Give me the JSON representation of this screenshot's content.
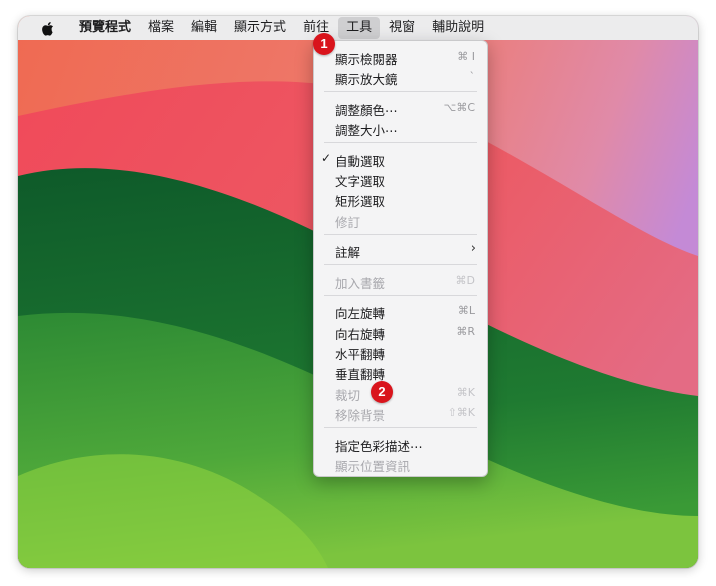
{
  "menubar": {
    "apple_icon": "apple-logo-icon",
    "items": [
      {
        "label": "預覽程式"
      },
      {
        "label": "檔案"
      },
      {
        "label": "編輯"
      },
      {
        "label": "顯示方式"
      },
      {
        "label": "前往"
      },
      {
        "label": "工具"
      },
      {
        "label": "視窗"
      },
      {
        "label": "輔助說明"
      }
    ]
  },
  "tools_menu": {
    "items": [
      {
        "label": "顯示檢閱器",
        "shortcut": "⌘ I",
        "enabled": true
      },
      {
        "label": "顯示放大鏡",
        "shortcut": "`",
        "enabled": true
      },
      {
        "label": "調整顏色⋯",
        "shortcut": "⌥⌘C",
        "enabled": true
      },
      {
        "label": "調整大小⋯",
        "shortcut": "",
        "enabled": true
      },
      {
        "label": "自動選取",
        "shortcut": "",
        "enabled": true,
        "checked": true
      },
      {
        "label": "文字選取",
        "shortcut": "",
        "enabled": true
      },
      {
        "label": "矩形選取",
        "shortcut": "",
        "enabled": true
      },
      {
        "label": "修訂",
        "shortcut": "",
        "enabled": false
      },
      {
        "label": "註解",
        "shortcut": "",
        "enabled": true,
        "submenu": true
      },
      {
        "label": "加入書籤",
        "shortcut": "⌘D",
        "enabled": false
      },
      {
        "label": "向左旋轉",
        "shortcut": "⌘L",
        "enabled": true
      },
      {
        "label": "向右旋轉",
        "shortcut": "⌘R",
        "enabled": true
      },
      {
        "label": "水平翻轉",
        "shortcut": "",
        "enabled": true
      },
      {
        "label": "垂直翻轉",
        "shortcut": "",
        "enabled": true
      },
      {
        "label": "裁切",
        "shortcut": "⌘K",
        "enabled": false
      },
      {
        "label": "移除背景",
        "shortcut": "⇧⌘K",
        "enabled": false
      },
      {
        "label": "指定色彩描述⋯",
        "shortcut": "",
        "enabled": true
      },
      {
        "label": "顯示位置資訊",
        "shortcut": "",
        "enabled": false
      }
    ]
  },
  "badges": [
    "1",
    "2"
  ],
  "colors": {
    "badge": "#d9141c",
    "menubar": "#ececed",
    "menu_bg": "#f4f4f5"
  }
}
